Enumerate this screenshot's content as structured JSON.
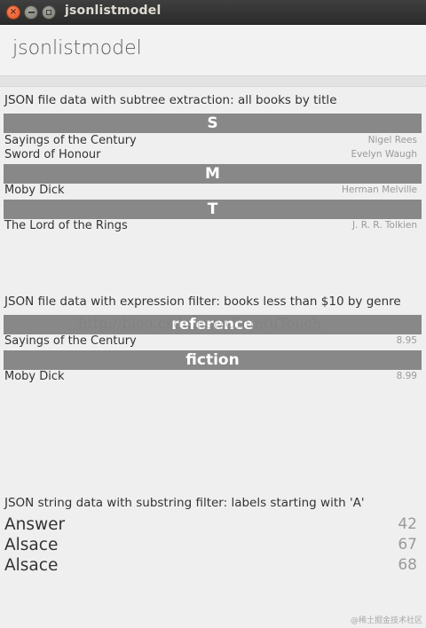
{
  "window": {
    "title": "jsonlistmodel",
    "close_glyph": "×",
    "icons": [
      "close-icon",
      "minimize-icon",
      "maximize-icon"
    ]
  },
  "header": {
    "title": "jsonlistmodel"
  },
  "section1": {
    "caption": "JSON file data with subtree extraction: all books by title",
    "groups": [
      {
        "header": "S",
        "items": [
          {
            "title": "Sayings of the Century",
            "author": "Nigel Rees"
          },
          {
            "title": "Sword of Honour",
            "author": "Evelyn Waugh"
          }
        ]
      },
      {
        "header": "M",
        "items": [
          {
            "title": "Moby Dick",
            "author": "Herman Melville"
          }
        ]
      },
      {
        "header": "T",
        "items": [
          {
            "title": "The Lord of the Rings",
            "author": "J. R. R. Tolkien"
          }
        ]
      }
    ]
  },
  "section2": {
    "caption": "JSON file data with expression filter: books less than $10 by genre",
    "groups": [
      {
        "header": "reference",
        "items": [
          {
            "title": "Sayings of the Century",
            "price": "8.95"
          }
        ]
      },
      {
        "header": "fiction",
        "items": [
          {
            "title": "Moby Dick",
            "price": "8.99"
          }
        ]
      }
    ]
  },
  "section3": {
    "caption": "JSON string data with substring filter: labels starting with 'A'",
    "items": [
      {
        "label": "Answer",
        "value": "42"
      },
      {
        "label": "Alsace",
        "value": "67"
      },
      {
        "label": "Alsace",
        "value": "68"
      }
    ]
  },
  "watermarks": {
    "center": "http://blog.csdn.net/UbuntuTouch",
    "corner": "@稀土掘金技术社区"
  },
  "colors": {
    "group_header_bg": "#888888",
    "background": "#efefef",
    "titlebar": "#3c3b37"
  }
}
